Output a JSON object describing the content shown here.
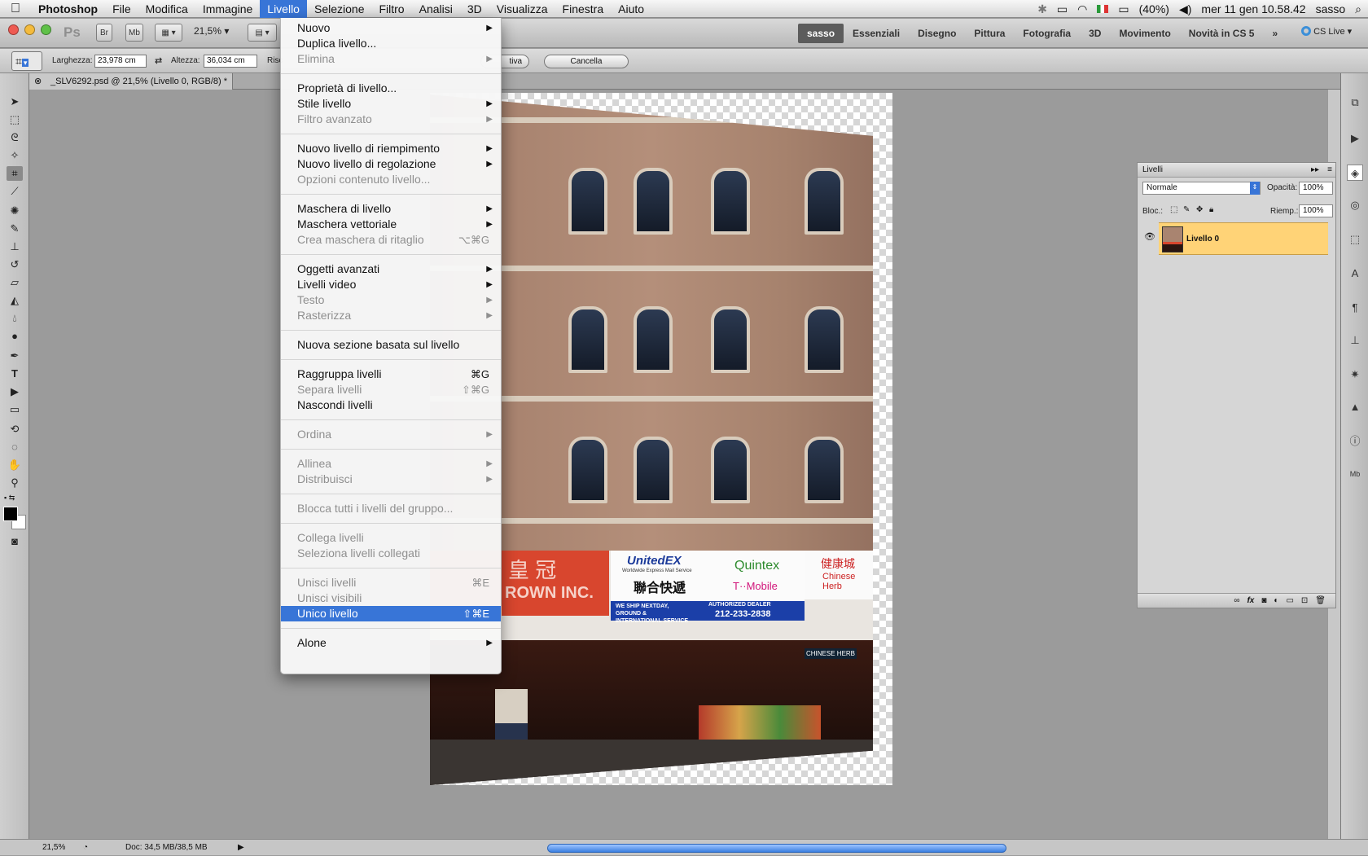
{
  "menubar": {
    "app_name": "Photoshop",
    "items": [
      "File",
      "Modifica",
      "Immagine",
      "Livello",
      "Selezione",
      "Filtro",
      "Analisi",
      "3D",
      "Visualizza",
      "Finestra",
      "Aiuto"
    ],
    "active_menu": "Livello",
    "battery": "(40%)",
    "clock": "mer 11 gen  10.58.42",
    "user": "sasso"
  },
  "appbar": {
    "zoom": "21,5%",
    "bridge_label": "Br",
    "minibridge_label": "Mb",
    "workspaces": [
      "sasso",
      "Essenziali",
      "Disegno",
      "Pittura",
      "Fotografia",
      "3D",
      "Movimento",
      "Novità in CS 5"
    ],
    "active_workspace": "sasso",
    "cslive": "CS Live"
  },
  "options": {
    "width_label": "Larghezza:",
    "width_value": "23,978 cm",
    "height_label": "Altezza:",
    "height_value": "36,034 cm",
    "resolution_label": "Risc",
    "front_button": "tiva",
    "cancel_button": "Cancella"
  },
  "document": {
    "tab_title": "_SLV6292.psd @ 21,5% (Livello 0, RGB/8) *"
  },
  "photo": {
    "signs": {
      "unitedex": "UnitedEX",
      "unitedex_sub": "Worldwide Express Mail Service",
      "chinese_center": "聯合快遞",
      "quintex": "Quintex",
      "tmobile": "T··Mobile",
      "crown_left": "皇 冠",
      "crown_text": "ROWN INC.",
      "shipping": "WE SHIP NEXTDAY, GROUND & INTERNATIONAL SERVICE",
      "dealer": "AUTHORIZED DEALER",
      "phone": "212-233-2838",
      "herbs": "Chinese Herb",
      "herbs_cn": "健康城",
      "herbs_store": "CHINESE HERB"
    }
  },
  "layers_panel": {
    "title": "Livelli",
    "blend_mode": "Normale",
    "opacity_label": "Opacità:",
    "opacity_value": "100%",
    "lock_label": "Bloc.:",
    "fill_label": "Riemp.:",
    "fill_value": "100%",
    "layer_name": "Livello 0"
  },
  "menu": {
    "groups": [
      [
        {
          "label": "Nuovo",
          "sub": true
        },
        {
          "label": "Duplica livello..."
        },
        {
          "label": "Elimina",
          "sub": true,
          "disabled": true
        }
      ],
      [
        {
          "label": "Proprietà di livello..."
        },
        {
          "label": "Stile livello",
          "sub": true
        },
        {
          "label": "Filtro avanzato",
          "sub": true,
          "disabled": true
        }
      ],
      [
        {
          "label": "Nuovo livello di riempimento",
          "sub": true
        },
        {
          "label": "Nuovo livello di regolazione",
          "sub": true
        },
        {
          "label": "Opzioni contenuto livello...",
          "disabled": true
        }
      ],
      [
        {
          "label": "Maschera di livello",
          "sub": true
        },
        {
          "label": "Maschera vettoriale",
          "sub": true
        },
        {
          "label": "Crea maschera di ritaglio",
          "shortcut": "⌥⌘G",
          "disabled": true
        }
      ],
      [
        {
          "label": "Oggetti avanzati",
          "sub": true
        },
        {
          "label": "Livelli video",
          "sub": true
        },
        {
          "label": "Testo",
          "sub": true,
          "disabled": true
        },
        {
          "label": "Rasterizza",
          "sub": true,
          "disabled": true
        }
      ],
      [
        {
          "label": "Nuova sezione basata sul livello"
        }
      ],
      [
        {
          "label": "Raggruppa livelli",
          "shortcut": "⌘G"
        },
        {
          "label": "Separa livelli",
          "shortcut": "⇧⌘G",
          "disabled": true
        },
        {
          "label": "Nascondi livelli"
        }
      ],
      [
        {
          "label": "Ordina",
          "sub": true,
          "disabled": true
        }
      ],
      [
        {
          "label": "Allinea",
          "sub": true,
          "disabled": true
        },
        {
          "label": "Distribuisci",
          "sub": true,
          "disabled": true
        }
      ],
      [
        {
          "label": "Blocca tutti i livelli del gruppo...",
          "disabled": true
        }
      ],
      [
        {
          "label": "Collega livelli",
          "disabled": true
        },
        {
          "label": "Seleziona livelli collegati",
          "disabled": true
        }
      ],
      [
        {
          "label": "Unisci livelli",
          "shortcut": "⌘E",
          "disabled": true
        },
        {
          "label": "Unisci visibili",
          "disabled": true
        },
        {
          "label": "Unico livello",
          "shortcut": "⇧⌘E",
          "highlight": true
        }
      ],
      [
        {
          "label": "Alone",
          "sub": true
        }
      ]
    ]
  },
  "statusbar": {
    "zoom": "21,5%",
    "doc_info": "Doc: 34,5 MB/38,5 MB"
  },
  "colors": {
    "menu_highlight": "#3875d7",
    "layer_selected": "#ffd377"
  }
}
